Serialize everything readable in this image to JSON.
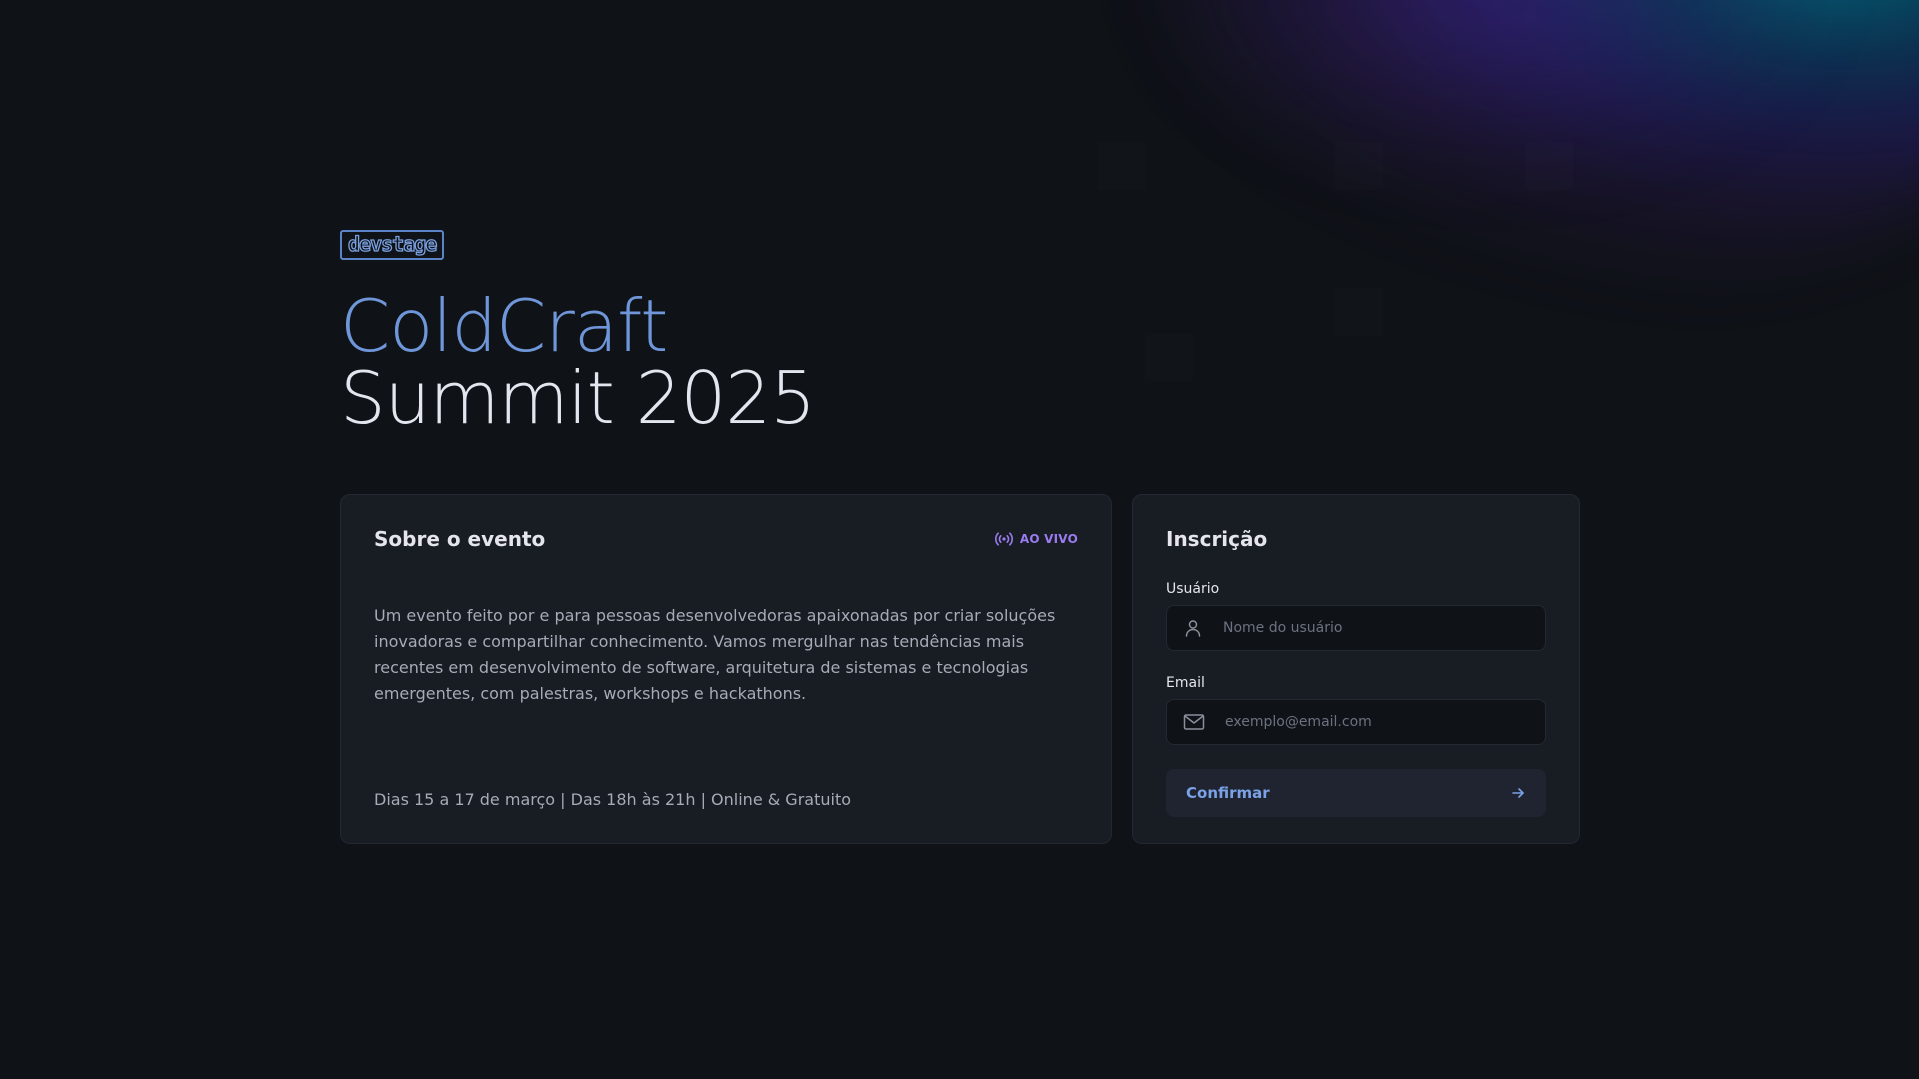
{
  "brand": {
    "logo_text": "devstage"
  },
  "hero": {
    "title_accent": "ColdCraft",
    "title_main": "Summit 2025"
  },
  "about": {
    "title": "Sobre o evento",
    "live_label": "AO VIVO",
    "description": "Um evento feito por e para pessoas desenvolvedoras apaixonadas por criar soluções inovadoras e compartilhar conhecimento. Vamos mergulhar nas tendências mais recentes em desenvolvimento de software, arquitetura de sistemas e tecnologias emergentes, com palestras, workshops e hackathons.",
    "footer": "Dias 15 a 17 de março | Das 18h às 21h | Online & Gratuito"
  },
  "signup": {
    "title": "Inscrição",
    "username_label": "Usuário",
    "username_placeholder": "Nome do usuário",
    "email_label": "Email",
    "email_placeholder": "exemplo@email.com",
    "confirm_label": "Confirmar"
  },
  "icons": {
    "live": "radio-broadcast-icon",
    "username": "user-icon",
    "email": "mail-icon",
    "confirm": "arrow-right-icon"
  },
  "colors": {
    "background": "#0f1217",
    "card": "#181c23",
    "accent_blue": "#6e96d8",
    "live_purple": "#9b7cf0"
  }
}
